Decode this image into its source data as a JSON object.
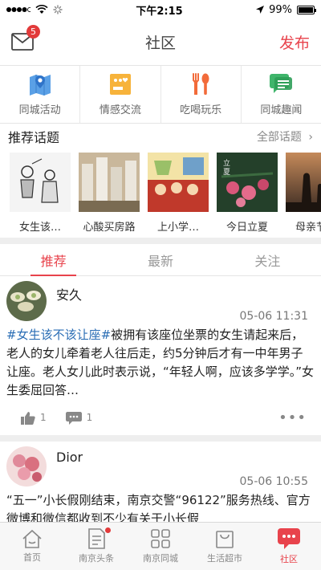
{
  "status": {
    "time": "下午2:15",
    "battery": "99%"
  },
  "nav": {
    "title": "社区",
    "publish": "发布",
    "badge": "5"
  },
  "categories": [
    {
      "label": "同城活动",
      "icon": "map-pin-icon",
      "color": "#4a90e2"
    },
    {
      "label": "情感交流",
      "icon": "heart-chat-icon",
      "color": "#f5a623"
    },
    {
      "label": "吃喝玩乐",
      "icon": "utensils-icon",
      "color": "#f26b3a"
    },
    {
      "label": "同城趣闻",
      "icon": "news-chat-icon",
      "color": "#3fb56b"
    }
  ],
  "recommend": {
    "title": "推荐话题",
    "more": "全部话题"
  },
  "topics": [
    {
      "label": "女生该…"
    },
    {
      "label": "心酸买房路"
    },
    {
      "label": "上小学…"
    },
    {
      "label": "今日立夏"
    },
    {
      "label": "母亲节买"
    }
  ],
  "tabs": [
    "推荐",
    "最新",
    "关注"
  ],
  "posts": [
    {
      "user": "安久",
      "time": "05-06 11:31",
      "hashtag": "#女生该不该让座#",
      "text": "被拥有该座位坐票的女生请起来后，老人的女儿牵着老人往后走，约5分钟后才有一中年男子让座。老人女儿此时表示说，“年轻人啊，应该多学学。”女生委屈回答…",
      "likes": "1",
      "comments": "1"
    },
    {
      "user": "Dior",
      "time": "05-06 10:55",
      "text": "“五一”小长假刚结束，南京交警“96122”服务热线、官方微博和微信都收到不少有关于小长假"
    }
  ],
  "tabbar": [
    "首页",
    "南京头条",
    "南京同城",
    "生活超市",
    "社区"
  ],
  "colors": {
    "accent": "#e8434c",
    "hashtag": "#2a6db5"
  }
}
